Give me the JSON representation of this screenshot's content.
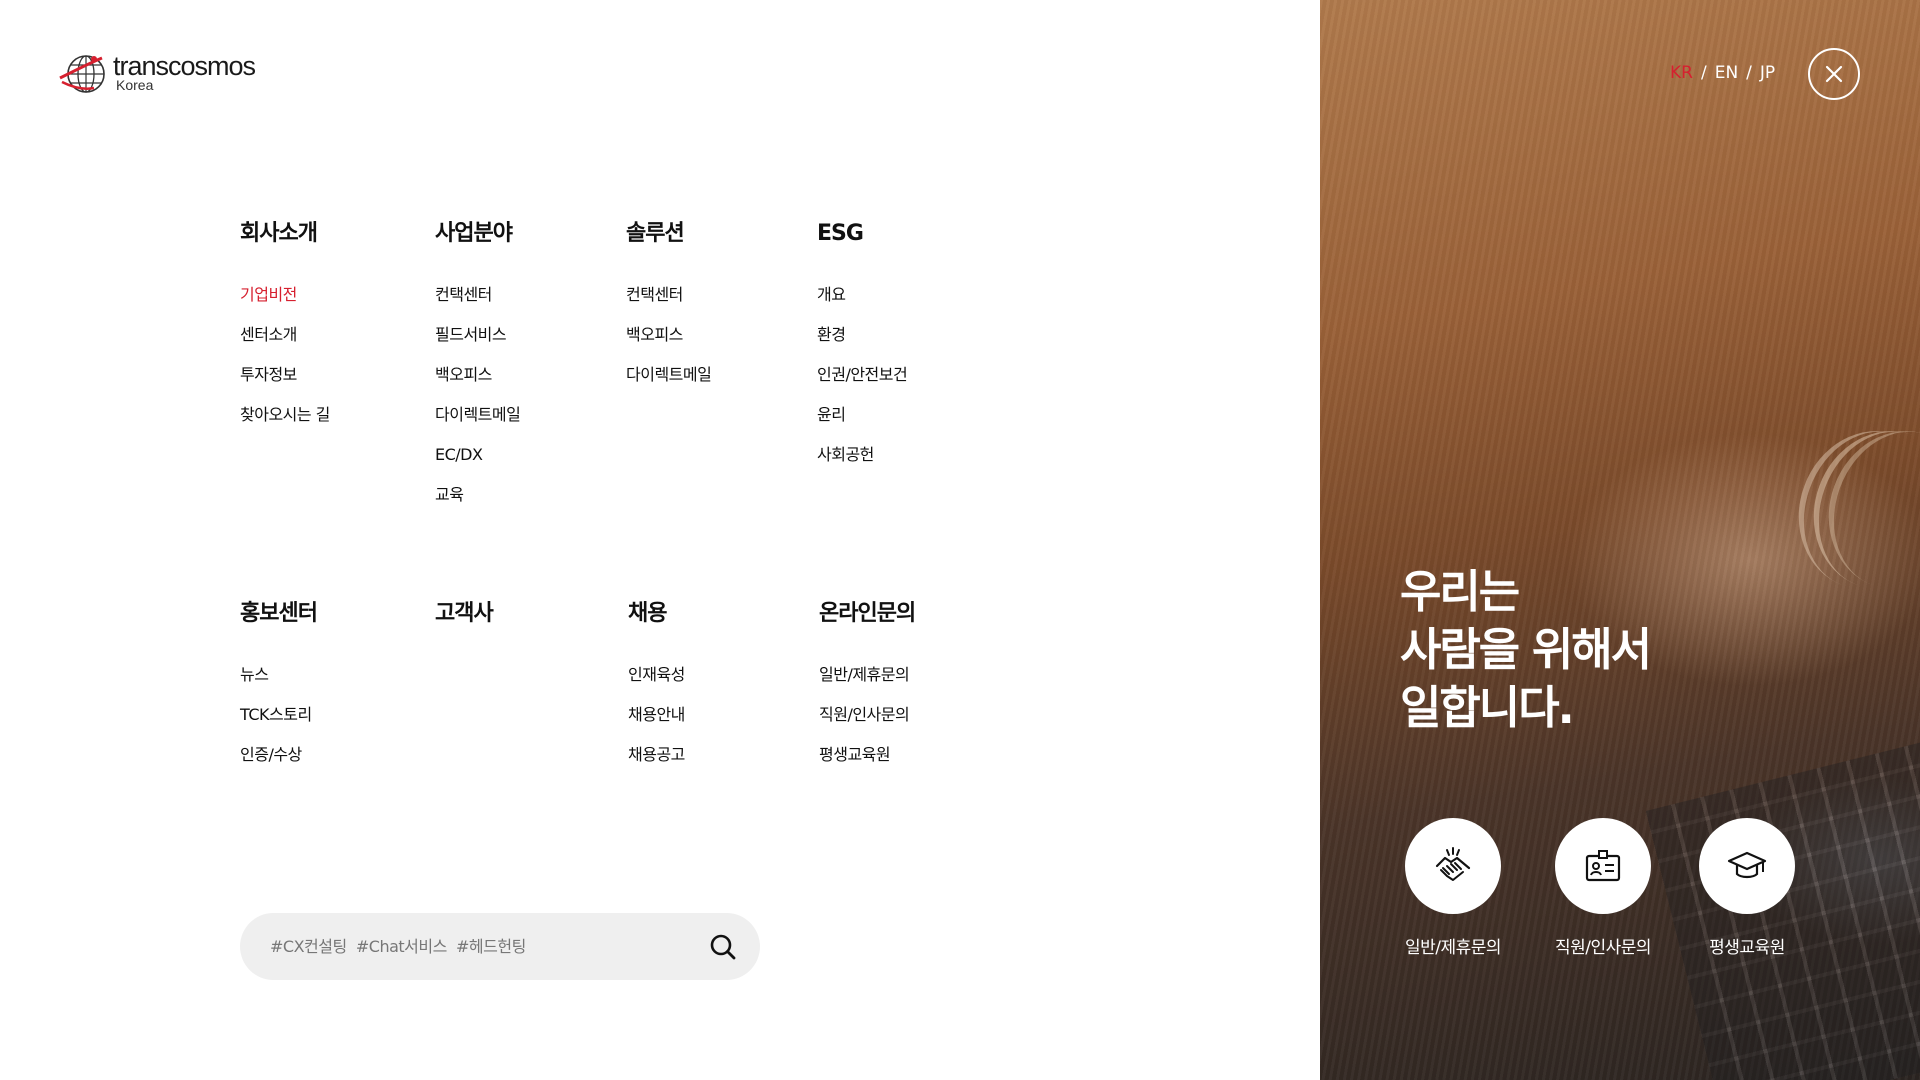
{
  "logo": {
    "text": "transcosmos",
    "sub": "Korea"
  },
  "menu": {
    "row1": [
      {
        "title": "회사소개",
        "items": [
          "기업비전",
          "센터소개",
          "투자정보",
          "찾아오시는 길"
        ]
      },
      {
        "title": "사업분야",
        "items": [
          "컨택센터",
          "필드서비스",
          "백오피스",
          "다이렉트메일",
          "EC/DX",
          "교육"
        ]
      },
      {
        "title": "솔루션",
        "items": [
          "컨택센터",
          "백오피스",
          "다이렉트메일"
        ]
      },
      {
        "title": "ESG",
        "items": [
          "개요",
          "환경",
          "인권/안전보건",
          "윤리",
          "사회공헌"
        ]
      }
    ],
    "row2": [
      {
        "title": "홍보센터",
        "items": [
          "뉴스",
          "TCK스토리",
          "인증/수상"
        ]
      },
      {
        "title": "고객사",
        "items": []
      },
      {
        "title": "채용",
        "items": [
          "인재육성",
          "채용안내",
          "채용공고"
        ]
      },
      {
        "title": "온라인문의",
        "items": [
          "일반/제휴문의",
          "직원/인사문의",
          "평생교육원"
        ]
      }
    ],
    "active_item": "기업비전"
  },
  "search": {
    "placeholder": "#CX컨설팅  #Chat서비스  #헤드헌팅",
    "icon": "search-icon"
  },
  "languages": {
    "items": [
      "KR",
      "EN",
      "JP"
    ],
    "active": "KR",
    "separator": "/"
  },
  "close": {
    "icon": "close-icon"
  },
  "slogan": {
    "lines": [
      "우리는",
      "사람을 위해서",
      "일합니다."
    ]
  },
  "quick_links": [
    {
      "label": "일반/제휴문의",
      "icon": "handshake-icon"
    },
    {
      "label": "직원/인사문의",
      "icon": "id-card-icon"
    },
    {
      "label": "평생교육원",
      "icon": "graduation-cap-icon"
    }
  ],
  "colors": {
    "accent": "#d6202f",
    "search_bg": "#efefef",
    "text": "#111111"
  }
}
